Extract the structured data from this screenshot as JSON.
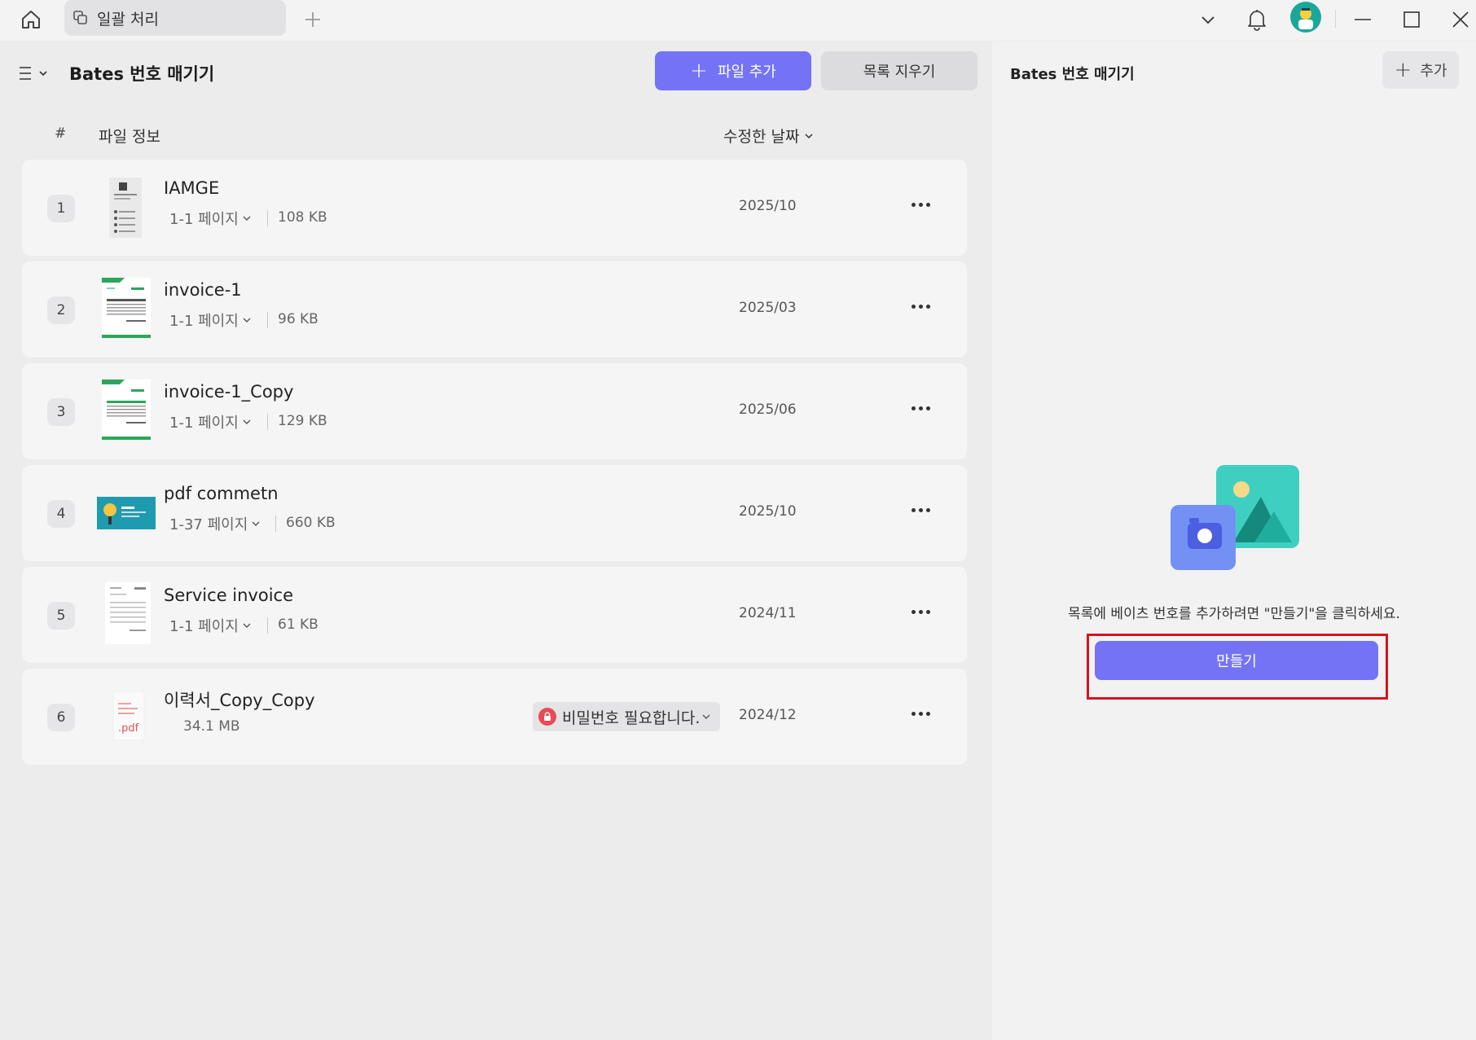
{
  "titlebar": {
    "tab_label": "일괄 처리",
    "icons": [
      "home-icon",
      "batch-tab-icon",
      "plus-icon",
      "chevron-down-icon",
      "bell-icon",
      "avatar",
      "minimize-icon",
      "maximize-icon",
      "close-icon"
    ]
  },
  "left": {
    "title": "Bates 번호 매기기",
    "add_files_label": "파일 추가",
    "clear_list_label": "목록 지우기",
    "col_num": "#",
    "col_info": "파일 정보",
    "col_date": "수정한 날짜",
    "files": [
      {
        "num": "1",
        "name": "IAMGE",
        "pages": "1-1 페이지",
        "size": "108 KB",
        "date": "2025/10",
        "thumb": "resume-thumb"
      },
      {
        "num": "2",
        "name": "invoice-1",
        "pages": "1-1 페이지",
        "size": "96 KB",
        "date": "2025/03",
        "thumb": "invoice-thumb"
      },
      {
        "num": "3",
        "name": "invoice-1_Copy",
        "pages": "1-1 페이지",
        "size": "129 KB",
        "date": "2025/06",
        "thumb": "invoice-thumb"
      },
      {
        "num": "4",
        "name": "pdf commetn",
        "pages": "1-37 페이지",
        "size": "660 KB",
        "date": "2025/10",
        "thumb": "slide-thumb"
      },
      {
        "num": "5",
        "name": "Service invoice",
        "pages": "1-1 페이지",
        "size": "61 KB",
        "date": "2024/11",
        "thumb": "doc-thumb"
      },
      {
        "num": "6",
        "name": "이력서_Copy_Copy",
        "pages": "",
        "size": "34.1 MB",
        "date": "2024/12",
        "thumb": "pdf-placeholder",
        "password_label": "비밀번호 필요합니다.",
        "thumb_text": ".pdf"
      }
    ]
  },
  "right": {
    "title": "Bates 번호 매기기",
    "add_label": "추가",
    "hint": "목록에 베이츠 번호를 추가하려면 \"만들기\"을 클릭하세요.",
    "create_label": "만들기"
  },
  "colors": {
    "accent": "#7473f6",
    "highlight_border": "#d7131b",
    "lock_red": "#e84b53",
    "avatar_teal": "#1aa79a"
  }
}
